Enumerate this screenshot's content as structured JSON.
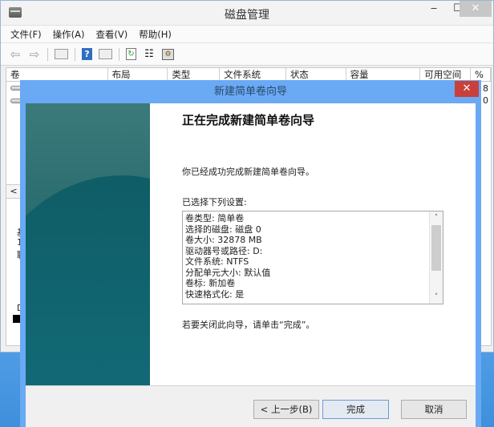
{
  "main_window": {
    "title": "磁盘管理",
    "controls": {
      "minimize": "‒",
      "maximize": "☐",
      "close": "✕"
    },
    "menu": [
      "文件(F)",
      "操作(A)",
      "查看(V)",
      "帮助(H)"
    ],
    "toolbar_icons": [
      "back-arrow-icon",
      "forward-arrow-icon",
      "show-hide-tree-icon",
      "help-icon",
      "show-hide-action-pane-icon",
      "refresh-icon",
      "properties-icon",
      "settings-icon"
    ],
    "columns": [
      "卷",
      "布局",
      "类型",
      "文件系统",
      "状态",
      "容量",
      "可用空间",
      "%"
    ],
    "right_edge_values": [
      "8",
      "0"
    ],
    "left_partial_text": [
      "基",
      "1",
      "联",
      "D"
    ],
    "scroll_left": "<"
  },
  "dialog": {
    "title": "新建简单卷向导",
    "close": "✕",
    "heading": "正在完成新建简单卷向导",
    "success_message": "你已经成功完成新建简单卷向导。",
    "settings_label": "已选择下列设置:",
    "settings": [
      "卷类型: 简单卷",
      "选择的磁盘: 磁盘 0",
      "卷大小: 32878 MB",
      "驱动器号或路径: D:",
      "文件系统: NTFS",
      "分配单元大小: 默认值",
      "卷标: 新加卷",
      "快速格式化: 是"
    ],
    "scroll_up": "˄",
    "scroll_down": "˅",
    "close_hint": "若要关闭此向导，请单击“完成”。",
    "buttons": {
      "back": "< 上一步(B)",
      "finish": "完成",
      "cancel": "取消"
    }
  }
}
